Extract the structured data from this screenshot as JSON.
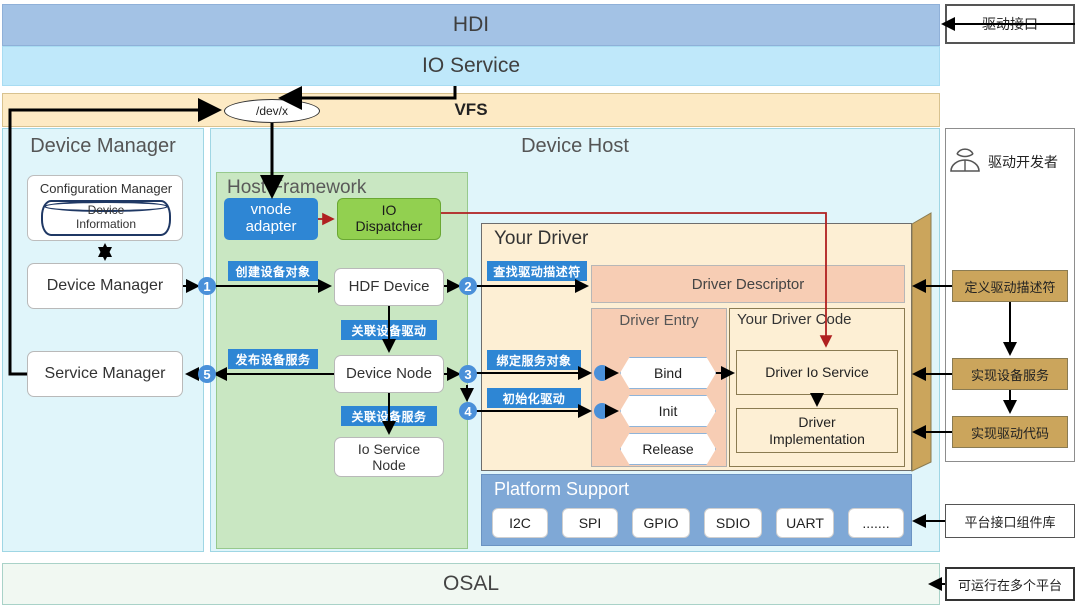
{
  "layers": {
    "hdi": "HDI",
    "io_service": "IO Service",
    "vfs": "VFS",
    "devx": "/dev/x",
    "osal": "OSAL"
  },
  "panes": {
    "device_manager": "Device Manager",
    "device_host": "Device Host"
  },
  "device_manager": {
    "configuration_manager": "Configuration Manager",
    "device_information": "Device\nInformation",
    "device_manager_box": "Device Manager",
    "service_manager_box": "Service Manager"
  },
  "host_framework": {
    "title": "Host Framework",
    "vnode_adapter": "vnode\nadapter",
    "io_dispatcher": "IO\nDispatcher",
    "hdf_device": "HDF Device",
    "device_node": "Device Node",
    "io_service_node": "Io Service\nNode",
    "label_create_device_object": "创建设备对象",
    "label_associate_device_driver": "关联设备驱动",
    "label_publish_device_service": "发布设备服务",
    "label_associate_device_service": "关联设备服务"
  },
  "your_driver": {
    "title": "Your Driver",
    "driver_descriptor": "Driver Descriptor",
    "driver_entry": "Driver Entry",
    "your_driver_code": "Your Driver Code",
    "bind": "Bind",
    "init": "Init",
    "release": "Release",
    "driver_io_service": "Driver Io Service",
    "driver_implementation": "Driver\nImplementation",
    "label_find_driver_descriptor": "查找驱动描述符",
    "label_bind_service_object": "绑定服务对象",
    "label_init_driver": "初始化驱动"
  },
  "platform_support": {
    "title": "Platform Support",
    "items": [
      "I2C",
      "SPI",
      "GPIO",
      "SDIO",
      "UART",
      "......."
    ]
  },
  "steps": [
    "1",
    "2",
    "3",
    "4",
    "5"
  ],
  "right_column": {
    "driver_interface": "驱动接口",
    "developer_title": "驱动开发者",
    "define_driver_descriptor": "定义驱动描述符",
    "implement_device_service": "实现设备服务",
    "implement_driver_code": "实现驱动代码",
    "platform_interface_library": "平台接口组件库",
    "runs_on_multiple_platforms": "可运行在多个平台"
  },
  "colors": {
    "hdi": "#a3c2e5",
    "io_service": "#bfe8fa",
    "vfs": "#fdeac4",
    "pane": "#e0f5fa",
    "host_framework": "#c9e7c2",
    "your_driver": "#fdefd4",
    "platform_support": "#7fa8d6",
    "accent_blue": "#2e86d4",
    "accent_green": "#92d050",
    "accent_tan": "#cba55c",
    "accent_peach": "#f7cdb4",
    "red_arrow": "#b02020"
  }
}
